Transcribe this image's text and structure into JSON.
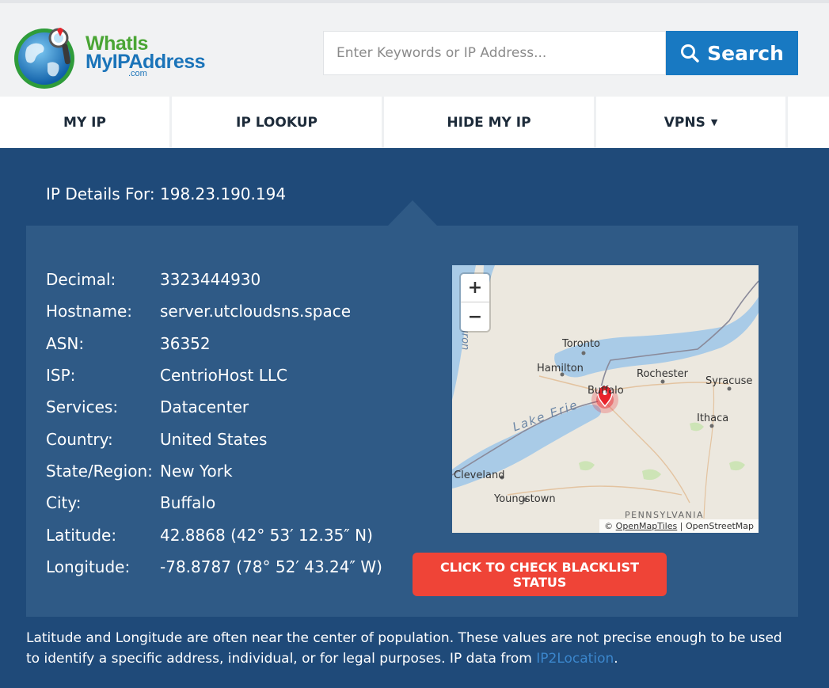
{
  "header": {
    "logo": {
      "line1": "WhatIs",
      "line2": "MyIPAddress",
      "suffix": ".com"
    },
    "search": {
      "placeholder": "Enter Keywords or IP Address...",
      "button_label": "Search"
    }
  },
  "nav": {
    "items": [
      {
        "label": "MY IP"
      },
      {
        "label": "IP LOOKUP"
      },
      {
        "label": "HIDE MY IP"
      },
      {
        "label": "VPNS",
        "caret": "▼"
      }
    ]
  },
  "details": {
    "title": "IP Details For: 198.23.190.194",
    "rows": [
      {
        "key": "Decimal:",
        "value": "3323444930"
      },
      {
        "key": "Hostname:",
        "value": "server.utcloudsns.space"
      },
      {
        "key": "ASN:",
        "value": "36352"
      },
      {
        "key": "ISP:",
        "value": "CentrioHost LLC"
      },
      {
        "key": "Services:",
        "value": "Datacenter"
      },
      {
        "key": "Country:",
        "value": "United States"
      },
      {
        "key": "State/Region:",
        "value": "New York"
      },
      {
        "key": "City:",
        "value": "Buffalo"
      },
      {
        "key": "Latitude:",
        "value": "42.8868 (42° 53′ 12.35″ N)"
      },
      {
        "key": "Longitude:",
        "value": "-78.8787 (78° 52′ 43.24″ W)"
      }
    ]
  },
  "map": {
    "zoom_in": "+",
    "zoom_out": "−",
    "labels": [
      "Toronto",
      "Hamilton",
      "Rochester",
      "Syracuse",
      "Buffalo",
      "Ithaca",
      "Lake Erie",
      "Cleveland",
      "Youngstown",
      "PENNSYLVANIA",
      "Huron"
    ],
    "attribution": {
      "prefix": "©",
      "link": "OpenMapTiles",
      "separator": "|",
      "source": "OpenStreetMap"
    },
    "colors": {
      "water": "#a9cbe7",
      "land": "#eae7df",
      "marker": "#e8242b"
    }
  },
  "blacklist_button": "CLICK TO CHECK BLACKLIST STATUS",
  "footer": {
    "text": "Latitude and Longitude are often near the center of population. These values are not precise enough to be used to identify a specific address, individual, or for legal purposes. IP data from ",
    "link": "IP2Location",
    "end": "."
  }
}
